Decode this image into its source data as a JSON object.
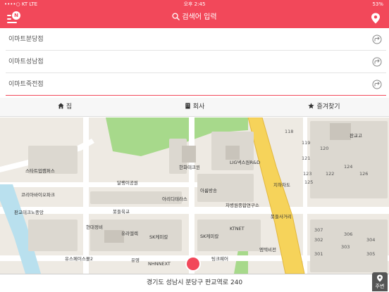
{
  "status_bar": {
    "carrier": "••••○ KT  LTE",
    "time": "오후 2:45",
    "battery": "53%"
  },
  "header": {
    "menu_badge": "N",
    "search_label": "검색어 입력"
  },
  "recent_places": [
    {
      "label": "이마트분당점"
    },
    {
      "label": "이마트성남점"
    },
    {
      "label": "이마트죽전점"
    }
  ],
  "tabs": [
    {
      "label": "집",
      "icon": "home-icon"
    },
    {
      "label": "회사",
      "icon": "building-icon"
    },
    {
      "label": "즐겨찾기",
      "icon": "star-icon"
    }
  ],
  "map": {
    "labels": {
      "startup_campus": "스타트업캠퍼스",
      "korea_bio_park": "코리아바이오파크",
      "pangyo_techno_center": "판교테크노중앙",
      "hyundai_jungbi": "현대정비",
      "universe_bridge": "유스페이스몰2",
      "dalpyeong_park": "달팽이공원",
      "hanwha_techwin": "한화테크윈",
      "lig_nex1": "LIG넥스원R&D",
      "ahrin_terrace": "아리디테라스",
      "ahrin_broadcast": "아름방송",
      "next_gen_center": "차병원종합연구소",
      "bongeun_school": "봇들육교",
      "yuraelec": "유라엘렉",
      "sk_chemical_1": "SK케미칼",
      "sk_chemical_2": "SK케미칼",
      "ktnet": "KTNET",
      "yuyoung": "유영",
      "nhn_next": "NHNNEXT",
      "tink_tower": "팅크웨어",
      "embit_vision": "엠텍비전",
      "pangyo_intersection": "봇들사거리",
      "jihachado": "지하차도",
      "pangyo_school": "판교고"
    },
    "block_numbers": [
      "118",
      "119",
      "120",
      "121",
      "122",
      "123",
      "124",
      "125",
      "126",
      "307",
      "306",
      "302",
      "303",
      "304",
      "301",
      "305"
    ],
    "road_colors": {
      "main": "#f6d35a",
      "edge": "#e2b73d",
      "park": "#a7d98b"
    }
  },
  "footer": {
    "address": "경기도 성남시 분당구 판교역로 240",
    "around_label": "주변"
  },
  "colors": {
    "accent": "#f2485a"
  }
}
